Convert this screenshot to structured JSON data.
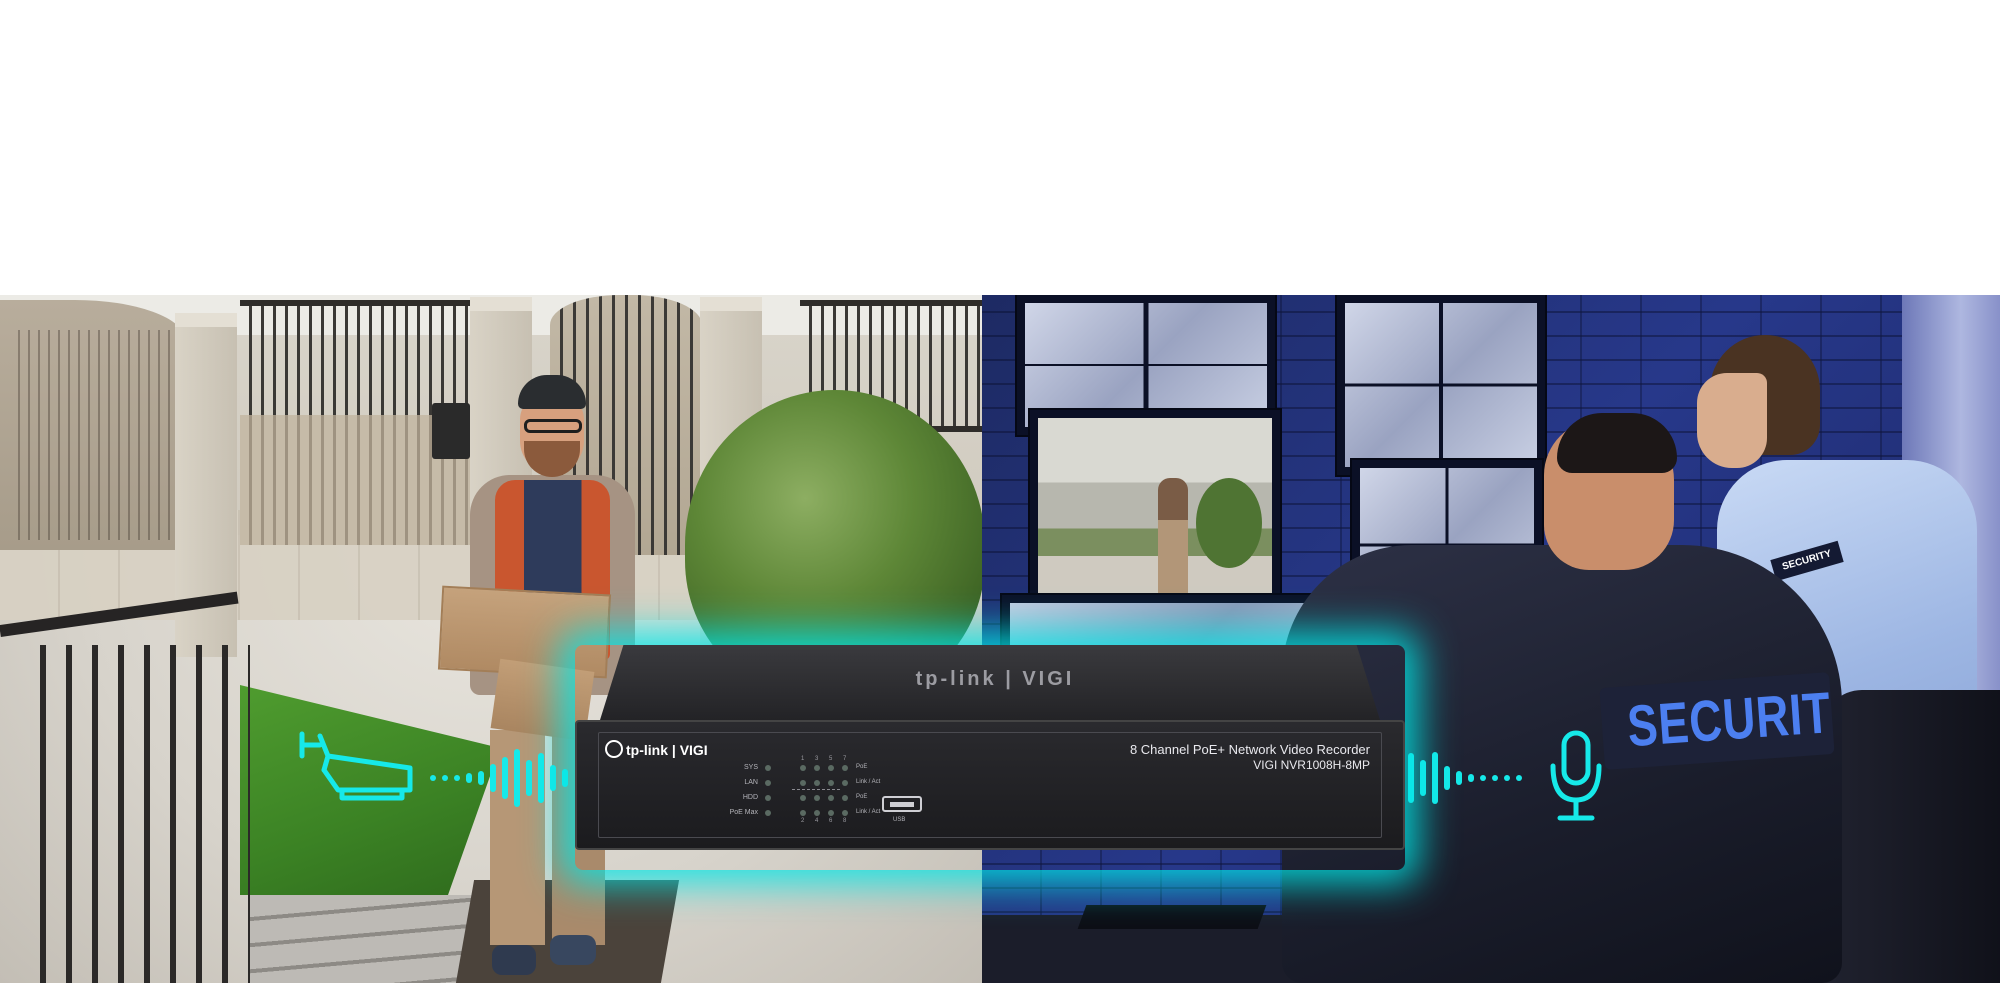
{
  "colors": {
    "accent_cyan": "#16e9e9",
    "background": "#ffffff",
    "security_text": "#4c7ff0",
    "nvr_body": "#232326"
  },
  "icons": {
    "camera": "security-camera-icon",
    "microphone": "microphone-icon"
  },
  "patches": {
    "large": "SECURITY",
    "small": "SECURITY"
  },
  "nvr": {
    "top_logo": "tp-link | VIGI",
    "front_brand": "tp-link | VIGI",
    "model_title": "8 Channel PoE+ Network Video Recorder",
    "model_number": "VIGI NVR1008H-8MP",
    "led_labels": [
      "SYS",
      "LAN",
      "HDD",
      "PoE Max"
    ],
    "port_numbers_top": [
      "1",
      "3",
      "5",
      "7"
    ],
    "port_numbers_bottom": [
      "2",
      "4",
      "6",
      "8"
    ],
    "port_row_labels": [
      "PoE",
      "Link / Act",
      "PoE",
      "Link / Act"
    ],
    "usb_label": "USB"
  }
}
